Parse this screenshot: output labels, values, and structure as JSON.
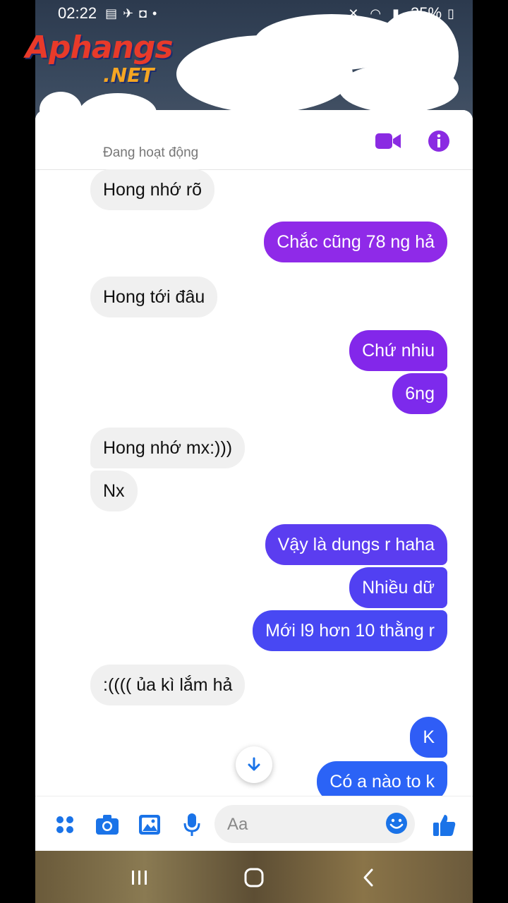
{
  "status_bar": {
    "time": "02:22",
    "battery": "35%"
  },
  "watermark": {
    "name": "Aphangs",
    "suffix": ".NET"
  },
  "header": {
    "status_text": "Đang hoạt động",
    "video_icon": "video-camera-icon",
    "info_icon": "info-icon"
  },
  "colors": {
    "accent": "#8a2be2",
    "out_top": "#9b27e6",
    "out_bottom": "#2b63f6",
    "icon_blue": "#1a73e8"
  },
  "messages": [
    {
      "dir": "in",
      "text": "Hong nhớ rõ"
    },
    {
      "dir": "out",
      "text": "Chắc cũng 78 ng hả"
    },
    {
      "dir": "in",
      "text": "Hong tới đâu"
    },
    {
      "dir": "out",
      "text": "Chứ nhiu"
    },
    {
      "dir": "out",
      "text": "6ng"
    },
    {
      "dir": "in",
      "text": "Hong nhớ mx:)))"
    },
    {
      "dir": "in",
      "text": "Nx"
    },
    {
      "dir": "out",
      "text": "Vậy là dungs r haha"
    },
    {
      "dir": "out",
      "text": "Nhiều dữ"
    },
    {
      "dir": "out",
      "text": "Mới l9 hơn 10 thằng r"
    },
    {
      "dir": "in",
      "text": ":(((( ủa kì lắm hả"
    },
    {
      "dir": "out",
      "text": "K"
    },
    {
      "dir": "out",
      "text": "Có a nào to k"
    }
  ],
  "composer": {
    "placeholder": "Aa",
    "icons": [
      "menu-dots-icon",
      "camera-icon",
      "gallery-icon",
      "microphone-icon",
      "emoji-icon",
      "thumbs-up-icon"
    ]
  }
}
